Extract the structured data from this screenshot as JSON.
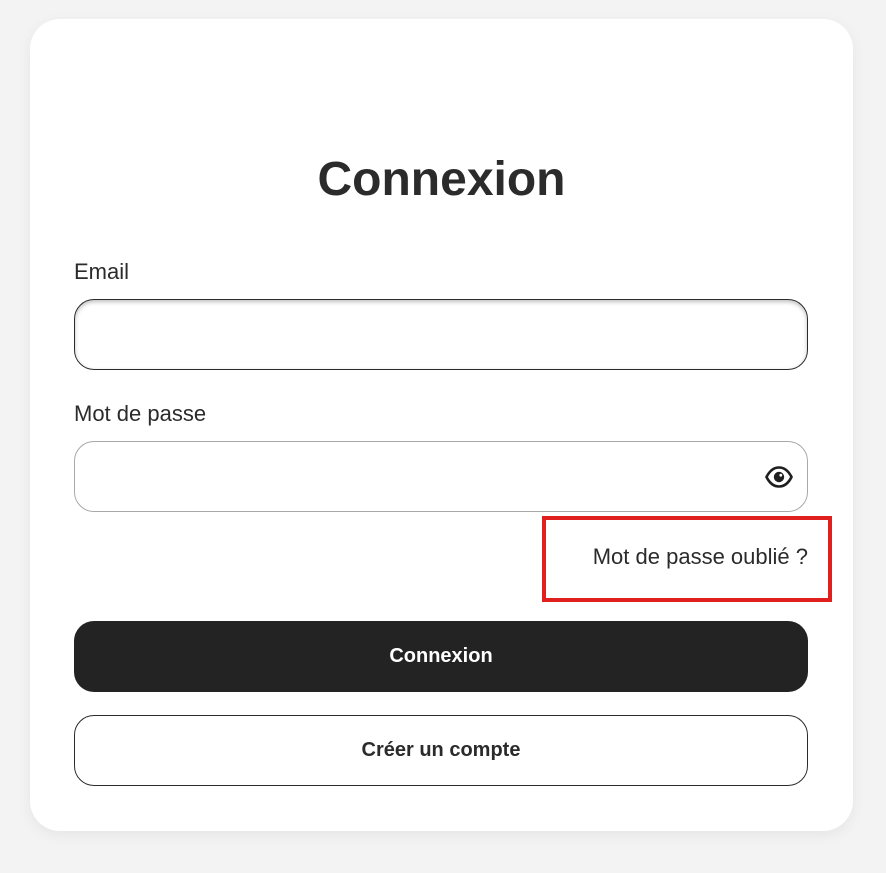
{
  "login": {
    "title": "Connexion",
    "email_label": "Email",
    "email_value": "",
    "password_label": "Mot de passe",
    "password_value": "",
    "show_password_icon": "eye-icon",
    "forgot_password_link": "Mot de passe oublié ?",
    "submit_button": "Connexion",
    "create_account_button": "Créer un compte"
  },
  "colors": {
    "background": "#f3f3f3",
    "card": "#ffffff",
    "text": "#2b2b2b",
    "primary_button": "#232323",
    "highlight_border": "#e01f1f"
  }
}
